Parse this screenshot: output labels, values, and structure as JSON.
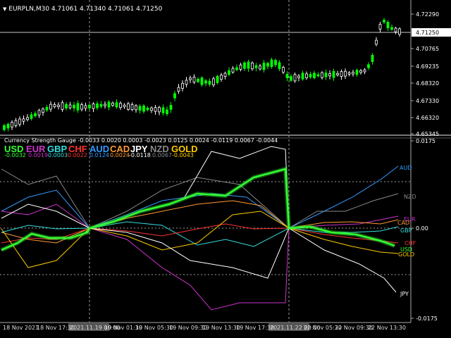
{
  "colors": {
    "background": "#000000",
    "grid": "#9a9a9a",
    "bull_candle": "#00ff00",
    "bear_candle": "#ffffff",
    "price_line": "#c8c8c8",
    "main_line": "#33ff33"
  },
  "price_chart": {
    "title": "EURPLN,M30  4.71061 4.71340 4.71061 4.71250",
    "current_price": "4.71250",
    "price_ticks": [
      "4.72290",
      "4.70765",
      "4.69235",
      "4.68320",
      "4.67330",
      "4.66320",
      "4.65345"
    ]
  },
  "indicator": {
    "title": "Currency Strength Gauge -0.0033 0.0020 0.0003 -0.0023 0.0125 0.0024 -0.0119 0.0067 -0.0044",
    "value_ticks": [
      "0.0175",
      "0.00",
      "-0.0175"
    ],
    "currencies": [
      {
        "name": "USD",
        "value": "-0.0032",
        "color": "#33ff33"
      },
      {
        "name": "EUR",
        "value": "0.0019",
        "color": "#cc33cc"
      },
      {
        "name": "GBP",
        "value": "0.0003",
        "color": "#33dddd"
      },
      {
        "name": "CHF",
        "value": "-0.0022",
        "color": "#ff3333"
      },
      {
        "name": "AUD",
        "value": "0.0124",
        "color": "#3399ff"
      },
      {
        "name": "CAD",
        "value": "0.0024",
        "color": "#ff9933"
      },
      {
        "name": "JPY",
        "value": "-0.0118",
        "color": "#ffffff"
      },
      {
        "name": "NZD",
        "value": "0.0067",
        "color": "#888888"
      },
      {
        "name": "GOLD",
        "value": "-0.0043",
        "color": "#ffcc00"
      }
    ],
    "end_labels": [
      "AUD",
      "NZD",
      "EUR",
      "CAD",
      "GBP",
      "CHF",
      "USD",
      "GOLD",
      "JPY"
    ]
  },
  "time_axis": {
    "labels": [
      "18 Nov 2021",
      "18 Nov 17:30",
      "2021.11.19 00:00",
      "19 Nov 01:30",
      "19 Nov 05:30",
      "19 Nov 09:30",
      "19 Nov 13:30",
      "19 Nov 17:30",
      "2021.11.22 00:00",
      "22 Nov 05:30",
      "22 Nov 09:30",
      "22 Nov 13:30"
    ]
  }
}
